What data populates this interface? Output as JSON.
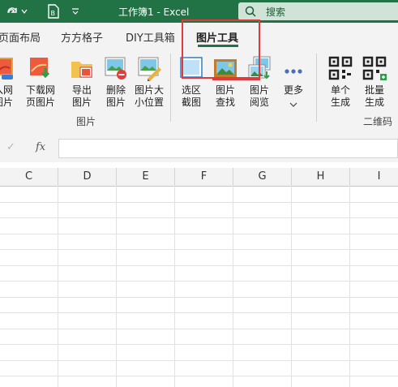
{
  "titlebar": {
    "title": "工作簿1 - Excel",
    "search_label": "搜索"
  },
  "tabs": [
    {
      "label": "页面布局"
    },
    {
      "label": "方方格子"
    },
    {
      "label": "DIY工具箱"
    },
    {
      "label": "图片工具",
      "active": true
    }
  ],
  "ribbon": {
    "buttons": [
      {
        "label": "入网\n图片",
        "icon": "insert-web-image-icon"
      },
      {
        "label": "下载网\n页图片",
        "icon": "download-web-image-icon"
      },
      {
        "label": "导出\n图片",
        "icon": "export-image-icon"
      },
      {
        "label": "删除\n图片",
        "icon": "delete-image-icon"
      },
      {
        "label": "图片大\n小位置",
        "icon": "image-size-position-icon"
      },
      {
        "label": "选区\n截图",
        "icon": "selection-screenshot-icon"
      },
      {
        "label": "图片\n查找",
        "icon": "image-find-icon"
      },
      {
        "label": "图片\n阅览",
        "icon": "image-browse-icon"
      },
      {
        "label": "更多",
        "icon": "more-dots-icon"
      },
      {
        "label": "单个\n生成",
        "icon": "qr-code-icon"
      },
      {
        "label": "批量\n生成",
        "icon": "qr-code-batch-icon"
      }
    ],
    "group_images": "图片",
    "group_qrcode": "二维码"
  },
  "formula_bar": {
    "cancel_symbol": "✓",
    "fx_symbol": "fx",
    "value": ""
  },
  "grid": {
    "columns": [
      "C",
      "D",
      "E",
      "F",
      "G",
      "H",
      "I"
    ]
  },
  "colors": {
    "accent": "#217346",
    "highlight": "#e03a3a"
  }
}
